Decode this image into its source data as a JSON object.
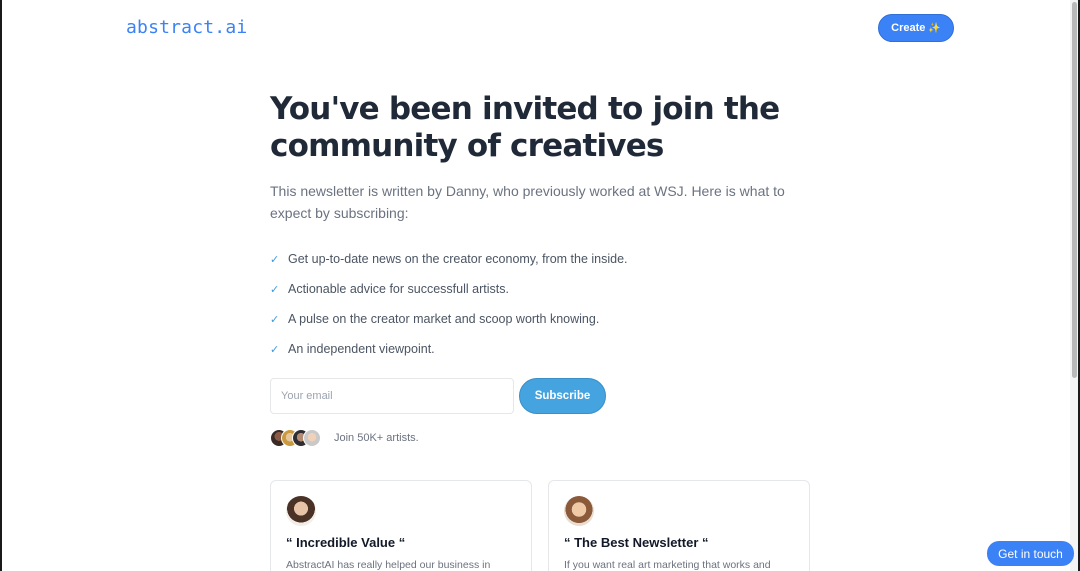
{
  "header": {
    "logo": "abstract.ai",
    "create_label": "Create",
    "create_icon": "sparkles-icon",
    "create_glyph": "✨"
  },
  "hero": {
    "headline": "You've been invited to join the community of creatives",
    "lead": "This newsletter is written by Danny, who previously worked at WSJ. Here is what to expect by subscribing:"
  },
  "features": [
    "Get up-to-date news on the creator economy, from the inside.",
    "Actionable advice for successfull artists.",
    "A pulse on the creator market and scoop worth knowing.",
    "An independent viewpoint."
  ],
  "subscribe": {
    "email_placeholder": "Your email",
    "button_label": "Subscribe",
    "social_proof": "Join 50K+ artists."
  },
  "testimonials": [
    {
      "title": "“ Incredible Value “",
      "text": "AbstractAI has really helped our business in"
    },
    {
      "title": "“ The Best Newsletter “",
      "text": "If you want real art marketing that works and"
    }
  ],
  "contact": {
    "label": "Get in touch"
  },
  "colors": {
    "accent": "#3b82f6",
    "subscribe": "#45a3e0",
    "heading": "#1f2937",
    "muted": "#6b7280"
  }
}
